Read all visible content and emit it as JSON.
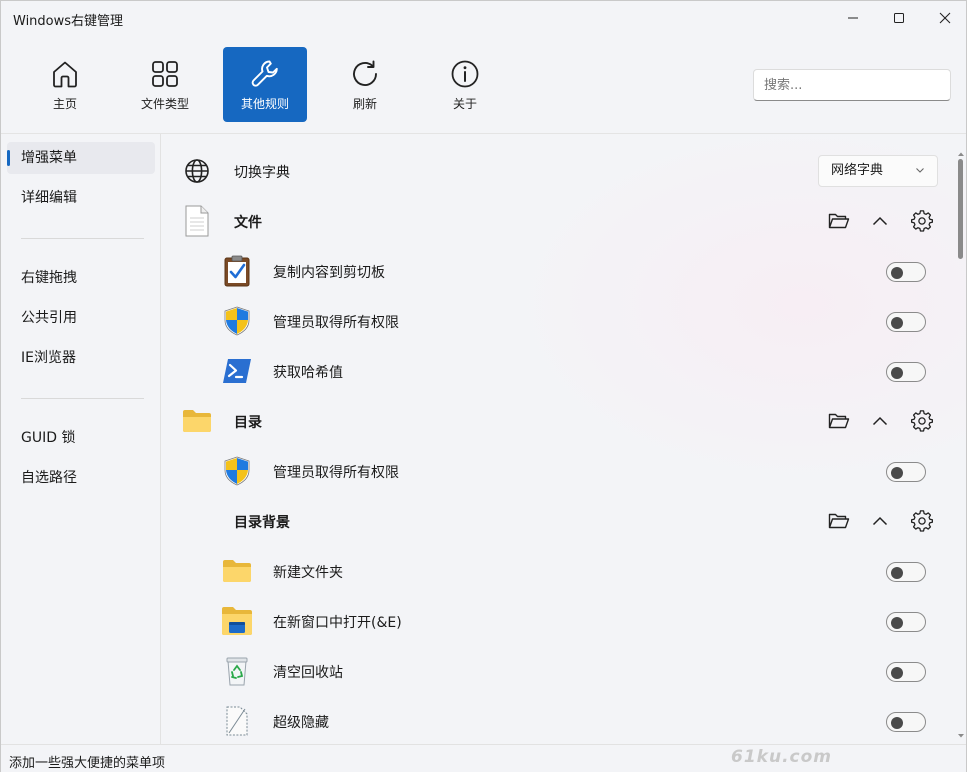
{
  "window": {
    "title": "Windows右键管理"
  },
  "toolbar": {
    "items": [
      {
        "label": "主页",
        "icon": "home-icon",
        "active": false
      },
      {
        "label": "文件类型",
        "icon": "grid-icon",
        "active": false
      },
      {
        "label": "其他规则",
        "icon": "wrench-icon",
        "active": true
      },
      {
        "label": "刷新",
        "icon": "refresh-icon",
        "active": false
      },
      {
        "label": "关于",
        "icon": "info-icon",
        "active": false
      }
    ],
    "search_placeholder": "搜索..."
  },
  "sidebar": {
    "items": [
      {
        "label": "增强菜单",
        "selected": true
      },
      {
        "label": "详细编辑"
      },
      {
        "label": "右键拖拽"
      },
      {
        "label": "公共引用"
      },
      {
        "label": "IE浏览器"
      },
      {
        "label": "GUID 锁"
      },
      {
        "label": "自选路径"
      }
    ]
  },
  "content": {
    "dictionary": {
      "label": "切换字典",
      "value": "网络字典",
      "icon": "globe-icon"
    },
    "rows": [
      {
        "label": "文件",
        "type": "section",
        "icon": "document-icon"
      },
      {
        "label": "复制内容到剪切板",
        "type": "item",
        "icon": "clipboard-icon",
        "enabled": false
      },
      {
        "label": "管理员取得所有权限",
        "type": "item",
        "icon": "uac-shield-icon",
        "enabled": false
      },
      {
        "label": "获取哈希值",
        "type": "item",
        "icon": "powershell-icon",
        "enabled": false
      },
      {
        "label": "目录",
        "type": "section",
        "icon": "folder-icon"
      },
      {
        "label": "管理员取得所有权限",
        "type": "item",
        "icon": "uac-shield-icon",
        "enabled": false
      },
      {
        "label": "目录背景",
        "type": "section",
        "icon": ""
      },
      {
        "label": "新建文件夹",
        "type": "item",
        "icon": "folder-icon",
        "enabled": false
      },
      {
        "label": "在新窗口中打开(&E)",
        "type": "item",
        "icon": "folder-window-icon",
        "enabled": false
      },
      {
        "label": "清空回收站",
        "type": "item",
        "icon": "recycle-bin-icon",
        "enabled": false
      },
      {
        "label": "超级隐藏",
        "type": "item",
        "icon": "hidden-file-icon",
        "enabled": false
      }
    ]
  },
  "status": {
    "text": "添加一些强大便捷的菜单项"
  },
  "watermark": {
    "text": "61ku.com"
  },
  "colors": {
    "accent": "#1668c1",
    "toggle_off_knob": "#4a4a4a"
  }
}
